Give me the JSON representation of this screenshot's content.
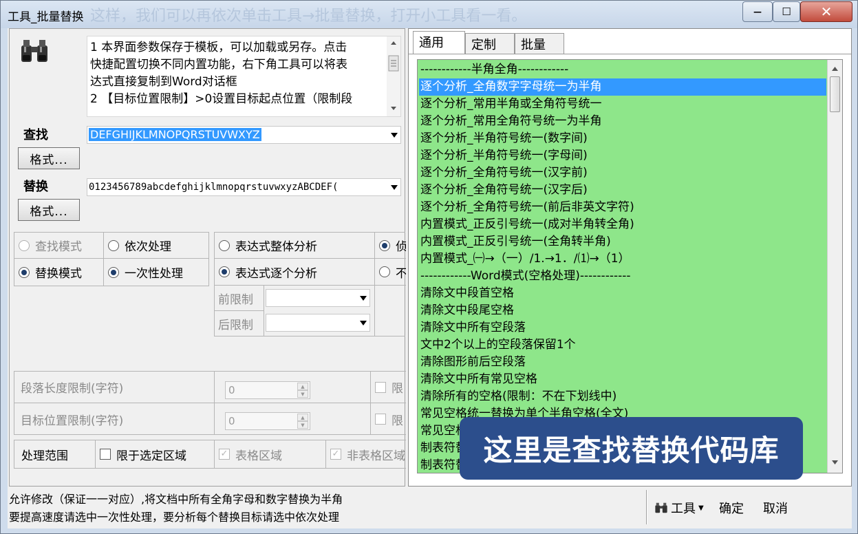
{
  "window": {
    "title": "工具_批量替换",
    "ghost_text": "这样，我们可以再依次单击工具→批量替换，打开小工具看一看。",
    "minimize_label": "—",
    "maximize_label": "☐",
    "close_label": "✕"
  },
  "left": {
    "description_lines": [
      "1 本界面参数保存于模板，可以加载或另存。点击",
      "快捷配置切换不同内置功能，右下角工具可以将表",
      "达式直接复制到Word对话框",
      "2 【目标位置限制】>0设置目标起点位置（限制段"
    ],
    "find_label": "查找",
    "find_value": "DEFGHIJKLMNOPQRSTUVWXYZ",
    "find_format_button": "格式...",
    "replace_label": "替换",
    "replace_value": "0123456789abcdefghijklmnopqrstuvwxyzABCDEF(",
    "replace_format_button": "格式...",
    "mode": {
      "find_mode": "查找模式",
      "replace_mode": "替换模式",
      "sequential": "依次处理",
      "one_time": "一次性处理",
      "expr_whole": "表达式整体分析",
      "expr_each": "表达式逐个分析",
      "col4_row1": "侦",
      "col4_row2": "不"
    },
    "prefix_label": "前限制",
    "suffix_label": "后限制",
    "para_len_label": "段落长度限制(字符)",
    "para_len_value": "0",
    "para_len_check": "限",
    "target_pos_label": "目标位置限制(字符)",
    "target_pos_value": "0",
    "target_pos_check": "限",
    "scope_label": "处理范围",
    "scope_selection": "限于选定区域",
    "scope_table": "表格区域",
    "scope_nontable": "非表格区域"
  },
  "tabs": [
    "通用",
    "定制",
    "批量"
  ],
  "list_items": [
    "------------半角全角------------",
    "逐个分析_全角数字字母统一为半角",
    "逐个分析_常用半角或全角符号统一",
    "逐个分析_常用全角符号统一为半角",
    "逐个分析_半角符号统一(数字间)",
    "逐个分析_半角符号统一(字母间)",
    "逐个分析_全角符号统一(汉字前)",
    "逐个分析_全角符号统一(汉字后)",
    "逐个分析_全角符号统一(前后非英文字符)",
    "内置模式_正反引号统一(成对半角转全角)",
    "内置模式_正反引号统一(全角转半角)",
    "内置模式_㈠→（一）/1.→1．/⑴→（1）",
    "------------Word模式(空格处理)------------",
    "清除文中段首空格",
    "清除文中段尾空格",
    "清除文中所有空段落",
    "文中2个以上的空段落保留1个",
    "清除图形前后空段落",
    "清除文中所有常见空格",
    "清除所有的空格(限制：不在下划线中)",
    "常见空格统一替换为单个半角空格(全文)",
    "常见空格",
    "制表符替",
    "制表符替"
  ],
  "overlay_text": "这里是查找替换代码库",
  "status": {
    "line1": "允许修改（保证一一对应）,将文档中所有全角字母和数字替换为半角",
    "line2": "要提高速度请选中一次性处理，要分析每个替换目标请选中依次处理",
    "tools_button": "工具",
    "ok_button": "确定",
    "cancel_button": "取消"
  },
  "colors": {
    "list_bg": "#8ee68a",
    "selection": "#3399ff",
    "overlay_bg": "#2c4e8c"
  }
}
